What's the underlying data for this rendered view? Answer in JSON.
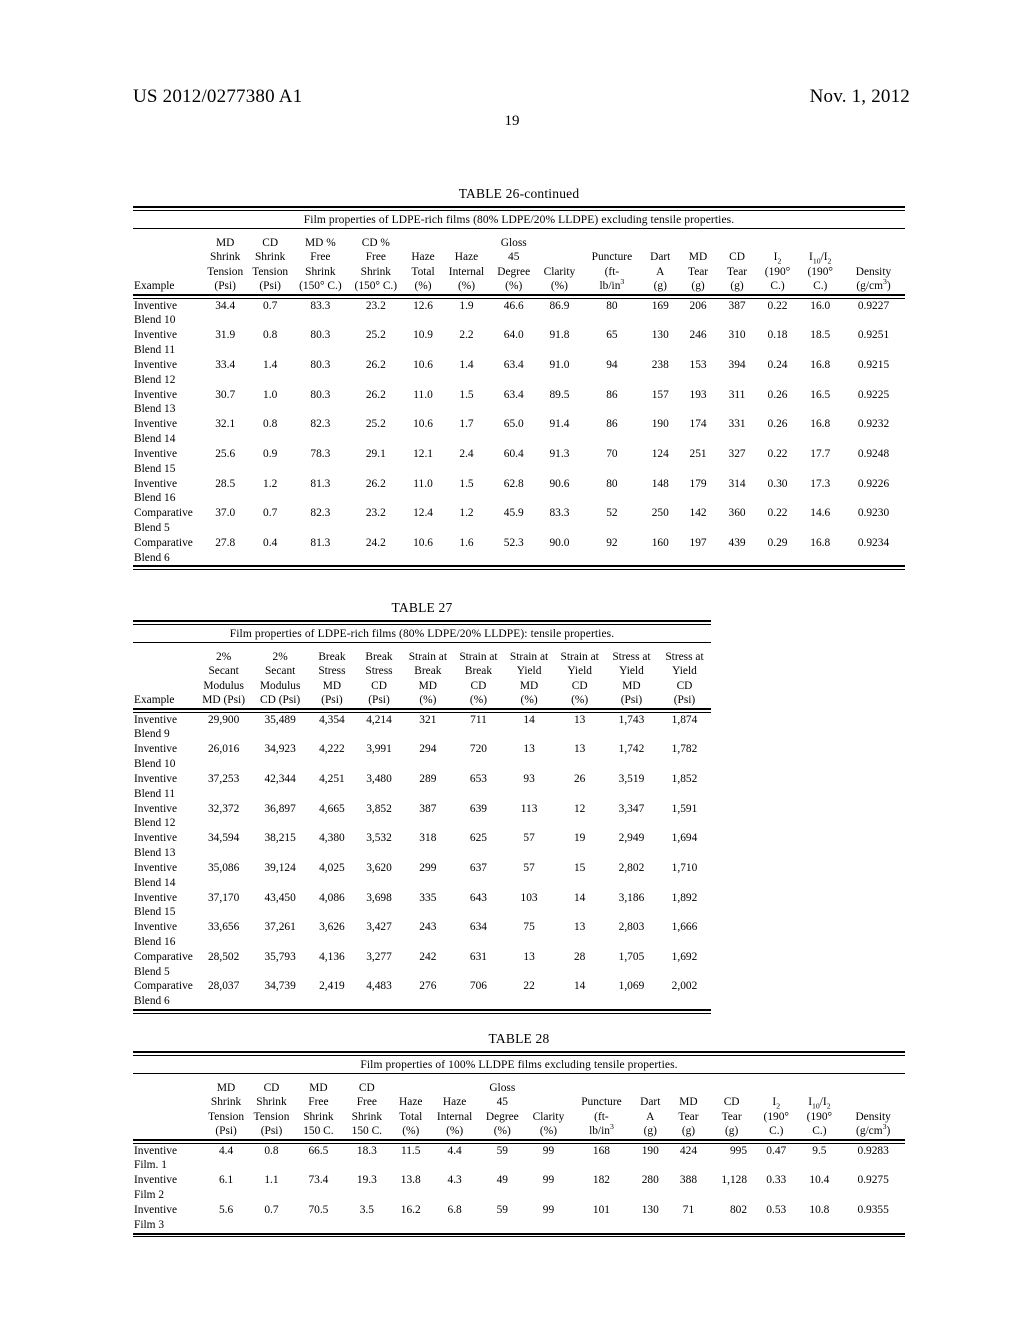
{
  "header": {
    "publication_number": "US 2012/0277380 A1",
    "publication_date": "Nov. 1, 2012",
    "page_number": "19"
  },
  "tables": [
    {
      "id": "table26",
      "title": "TABLE 26-continued",
      "caption": "Film properties of LDPE-rich films (80% LDPE/20% LLDPE) excluding tensile properties.",
      "columns": [
        {
          "lines": [
            "",
            "",
            "",
            "Example"
          ]
        },
        {
          "lines": [
            "MD",
            "Shrink",
            "Tension",
            "(Psi)"
          ]
        },
        {
          "lines": [
            "CD",
            "Shrink",
            "Tension",
            "(Psi)"
          ]
        },
        {
          "lines": [
            "MD %",
            "Free",
            "Shrink",
            "(150° C.)"
          ]
        },
        {
          "lines": [
            "CD %",
            "Free",
            "Shrink",
            "(150° C.)"
          ]
        },
        {
          "lines": [
            "",
            "Haze",
            "Total",
            "(%)"
          ]
        },
        {
          "lines": [
            "",
            "Haze",
            "Internal",
            "(%)"
          ]
        },
        {
          "lines": [
            "Gloss",
            "45",
            "Degree",
            "(%)"
          ]
        },
        {
          "lines": [
            "",
            "",
            "Clarity",
            "(%)"
          ]
        },
        {
          "lines": [
            "",
            "Puncture",
            "(ft-",
            "lb/in3"
          ],
          "sup_last": "3"
        },
        {
          "lines": [
            "",
            "Dart",
            "A",
            "(g)"
          ]
        },
        {
          "lines": [
            "",
            "MD",
            "Tear",
            "(g)"
          ]
        },
        {
          "lines": [
            "",
            "CD",
            "Tear",
            "(g)"
          ]
        },
        {
          "lines": [
            "",
            "I2",
            "(190°",
            "C.)"
          ]
        },
        {
          "lines": [
            "",
            "I10/I2",
            "(190°",
            "C.)"
          ]
        },
        {
          "lines": [
            "",
            "",
            "Density",
            "(g/cm3)"
          ]
        }
      ],
      "rows": [
        {
          "example": "Inventive Blend 10",
          "values": [
            "34.4",
            "0.7",
            "83.3",
            "23.2",
            "12.6",
            "1.9",
            "46.6",
            "86.9",
            "80",
            "169",
            "206",
            "387",
            "0.22",
            "16.0",
            "0.9227"
          ]
        },
        {
          "example": "Inventive Blend 11",
          "values": [
            "31.9",
            "0.8",
            "80.3",
            "25.2",
            "10.9",
            "2.2",
            "64.0",
            "91.8",
            "65",
            "130",
            "246",
            "310",
            "0.18",
            "18.5",
            "0.9251"
          ]
        },
        {
          "example": "Inventive Blend 12",
          "values": [
            "33.4",
            "1.4",
            "80.3",
            "26.2",
            "10.6",
            "1.4",
            "63.4",
            "91.0",
            "94",
            "238",
            "153",
            "394",
            "0.24",
            "16.8",
            "0.9215"
          ]
        },
        {
          "example": "Inventive Blend 13",
          "values": [
            "30.7",
            "1.0",
            "80.3",
            "26.2",
            "11.0",
            "1.5",
            "63.4",
            "89.5",
            "86",
            "157",
            "193",
            "311",
            "0.26",
            "16.5",
            "0.9225"
          ]
        },
        {
          "example": "Inventive Blend 14",
          "values": [
            "32.1",
            "0.8",
            "82.3",
            "25.2",
            "10.6",
            "1.7",
            "65.0",
            "91.4",
            "86",
            "190",
            "174",
            "331",
            "0.26",
            "16.8",
            "0.9232"
          ]
        },
        {
          "example": "Inventive Blend 15",
          "values": [
            "25.6",
            "0.9",
            "78.3",
            "29.1",
            "12.1",
            "2.4",
            "60.4",
            "91.3",
            "70",
            "124",
            "251",
            "327",
            "0.22",
            "17.7",
            "0.9248"
          ]
        },
        {
          "example": "Inventive Blend 16",
          "values": [
            "28.5",
            "1.2",
            "81.3",
            "26.2",
            "11.0",
            "1.5",
            "62.8",
            "90.6",
            "80",
            "148",
            "179",
            "314",
            "0.30",
            "17.3",
            "0.9226"
          ]
        },
        {
          "example": "Comparative Blend 5",
          "values": [
            "37.0",
            "0.7",
            "82.3",
            "23.2",
            "12.4",
            "1.2",
            "45.9",
            "83.3",
            "52",
            "250",
            "142",
            "360",
            "0.22",
            "14.6",
            "0.9230"
          ]
        },
        {
          "example": "Comparative Blend 6",
          "values": [
            "27.8",
            "0.4",
            "81.3",
            "24.2",
            "10.6",
            "1.6",
            "52.3",
            "90.0",
            "92",
            "160",
            "197",
            "439",
            "0.29",
            "16.8",
            "0.9234"
          ]
        }
      ]
    },
    {
      "id": "table27",
      "title": "TABLE 27",
      "caption": "Film properties of LDPE-rich films (80% LDPE/20% LLDPE): tensile properties.",
      "columns": [
        {
          "lines": [
            "",
            "",
            "",
            "Example"
          ]
        },
        {
          "lines": [
            "2%",
            "Secant",
            "Modulus",
            "MD (Psi)"
          ]
        },
        {
          "lines": [
            "2%",
            "Secant",
            "Modulus",
            "CD (Psi)"
          ]
        },
        {
          "lines": [
            "Break",
            "Stress",
            "MD",
            "(Psi)"
          ]
        },
        {
          "lines": [
            "Break",
            "Stress",
            "CD",
            "(Psi)"
          ]
        },
        {
          "lines": [
            "Strain at",
            "Break",
            "MD",
            "(%)"
          ]
        },
        {
          "lines": [
            "Strain at",
            "Break",
            "CD",
            "(%)"
          ]
        },
        {
          "lines": [
            "Strain at",
            "Yield",
            "MD",
            "(%)"
          ]
        },
        {
          "lines": [
            "Strain at",
            "Yield",
            "CD",
            "(%)"
          ]
        },
        {
          "lines": [
            "Stress at",
            "Yield",
            "MD",
            "(Psi)"
          ]
        },
        {
          "lines": [
            "Stress at",
            "Yield",
            "CD",
            "(Psi)"
          ]
        }
      ],
      "rows": [
        {
          "example": "Inventive Blend 9",
          "values": [
            "29,900",
            "35,489",
            "4,354",
            "4,214",
            "321",
            "711",
            "14",
            "13",
            "1,743",
            "1,874"
          ]
        },
        {
          "example": "Inventive Blend 10",
          "values": [
            "26,016",
            "34,923",
            "4,222",
            "3,991",
            "294",
            "720",
            "13",
            "13",
            "1,742",
            "1,782"
          ]
        },
        {
          "example": "Inventive Blend 11",
          "values": [
            "37,253",
            "42,344",
            "4,251",
            "3,480",
            "289",
            "653",
            "93",
            "26",
            "3,519",
            "1,852"
          ]
        },
        {
          "example": "Inventive Blend 12",
          "values": [
            "32,372",
            "36,897",
            "4,665",
            "3,852",
            "387",
            "639",
            "113",
            "12",
            "3,347",
            "1,591"
          ]
        },
        {
          "example": "Inventive Blend 13",
          "values": [
            "34,594",
            "38,215",
            "4,380",
            "3,532",
            "318",
            "625",
            "57",
            "19",
            "2,949",
            "1,694"
          ]
        },
        {
          "example": "Inventive Blend 14",
          "values": [
            "35,086",
            "39,124",
            "4,025",
            "3,620",
            "299",
            "637",
            "57",
            "15",
            "2,802",
            "1,710"
          ]
        },
        {
          "example": "Inventive Blend 15",
          "values": [
            "37,170",
            "43,450",
            "4,086",
            "3,698",
            "335",
            "643",
            "103",
            "14",
            "3,186",
            "1,892"
          ]
        },
        {
          "example": "Inventive Blend 16",
          "values": [
            "33,656",
            "37,261",
            "3,626",
            "3,427",
            "243",
            "634",
            "75",
            "13",
            "2,803",
            "1,666"
          ]
        },
        {
          "example": "Comparative Blend 5",
          "values": [
            "28,502",
            "35,793",
            "4,136",
            "3,277",
            "242",
            "631",
            "13",
            "28",
            "1,705",
            "1,692"
          ]
        },
        {
          "example": "Comparative Blend 6",
          "values": [
            "28,037",
            "34,739",
            "2,419",
            "4,483",
            "276",
            "706",
            "22",
            "14",
            "1,069",
            "2,002"
          ]
        }
      ]
    },
    {
      "id": "table28",
      "title": "TABLE 28",
      "caption": "Film properties of 100% LLDPE films excluding tensile properties.",
      "columns": [
        {
          "lines": [
            "",
            "",
            "",
            ""
          ]
        },
        {
          "lines": [
            "MD",
            "Shrink",
            "Tension",
            "(Psi)"
          ]
        },
        {
          "lines": [
            "CD",
            "Shrink",
            "Tension",
            "(Psi)"
          ]
        },
        {
          "lines": [
            "MD",
            "Free",
            "Shrink",
            "150 C."
          ]
        },
        {
          "lines": [
            "CD",
            "Free",
            "Shrink",
            "150 C."
          ]
        },
        {
          "lines": [
            "",
            "Haze",
            "Total",
            "(%)"
          ]
        },
        {
          "lines": [
            "",
            "Haze",
            "Internal",
            "(%)"
          ]
        },
        {
          "lines": [
            "Gloss",
            "45",
            "Degree",
            "(%)"
          ]
        },
        {
          "lines": [
            "",
            "",
            "Clarity",
            "(%)"
          ]
        },
        {
          "lines": [
            "",
            "Puncture",
            "(ft-",
            "lb/in3"
          ]
        },
        {
          "lines": [
            "",
            "Dart",
            "A",
            "(g)"
          ]
        },
        {
          "lines": [
            "",
            "MD",
            "Tear",
            "(g)"
          ]
        },
        {
          "lines": [
            "",
            "CD",
            "Tear",
            "(g)"
          ]
        },
        {
          "lines": [
            "",
            "I2",
            "(190°",
            "C.)"
          ]
        },
        {
          "lines": [
            "",
            "I10/I2",
            "(190°",
            "C.)"
          ]
        },
        {
          "lines": [
            "",
            "",
            "Density",
            "(g/cm3)"
          ]
        }
      ],
      "rows": [
        {
          "example": "Inventive Film. 1",
          "values": [
            "4.4",
            "0.8",
            "66.5",
            "18.3",
            "11.5",
            "4.4",
            "59",
            "99",
            "168",
            "190",
            "424",
            "995",
            "0.47",
            "9.5",
            "0.9283"
          ]
        },
        {
          "example": "Inventive Film 2",
          "values": [
            "6.1",
            "1.1",
            "73.4",
            "19.3",
            "13.8",
            "4.3",
            "49",
            "99",
            "182",
            "280",
            "388",
            "1,128",
            "0.33",
            "10.4",
            "0.9275"
          ]
        },
        {
          "example": "Inventive Film 3",
          "values": [
            "5.6",
            "0.7",
            "70.5",
            "3.5",
            "16.2",
            "6.8",
            "59",
            "99",
            "101",
            "130",
            "71",
            "802",
            "0.53",
            "10.8",
            "0.9355"
          ]
        }
      ]
    }
  ]
}
